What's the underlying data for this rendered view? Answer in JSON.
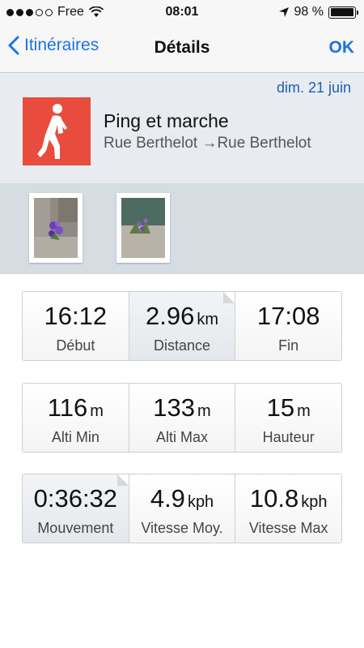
{
  "status_bar": {
    "carrier": "Free",
    "time": "08:01",
    "battery": "98 %",
    "battery_level": 0.98
  },
  "nav": {
    "back_label": "Itinéraires",
    "title": "Détails",
    "ok_label": "OK"
  },
  "activity": {
    "date": "dim. 21 juin",
    "name": "Ping et marche",
    "route": "Rue Berthelot →Rue Berthelot",
    "icon": "walker-icon",
    "icon_color": "#e84c3d"
  },
  "photos": [
    "photo-1",
    "photo-2"
  ],
  "stats": [
    [
      {
        "value": "16:12",
        "unit": "",
        "label": "Début"
      },
      {
        "value": "2.96",
        "unit": "km",
        "label": "Distance"
      },
      {
        "value": "17:08",
        "unit": "",
        "label": "Fin"
      }
    ],
    [
      {
        "value": "116",
        "unit": "m",
        "label": "Alti Min"
      },
      {
        "value": "133",
        "unit": "m",
        "label": "Alti Max"
      },
      {
        "value": "15",
        "unit": "m",
        "label": "Hauteur"
      }
    ],
    [
      {
        "value": "0:36:32",
        "unit": "",
        "label": "Mouvement"
      },
      {
        "value": "4.9",
        "unit": "kph",
        "label": "Vitesse Moy."
      },
      {
        "value": "10.8",
        "unit": "kph",
        "label": "Vitesse Max"
      }
    ]
  ],
  "colors": {
    "accent": "#1a74e0",
    "date": "#1a5fb4",
    "header_bg": "#e8ecf0",
    "photos_bg": "#d5dde3"
  }
}
